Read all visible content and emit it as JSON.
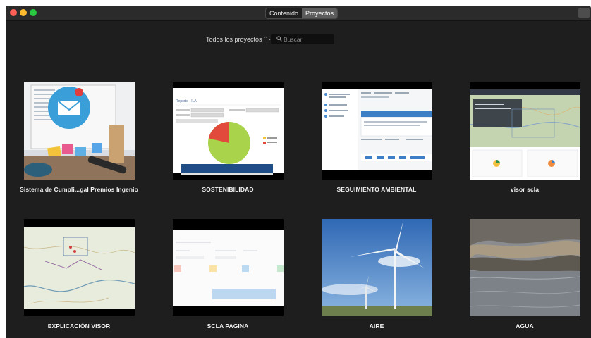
{
  "window": {
    "tabs": [
      {
        "label": "Contenido",
        "active": false
      },
      {
        "label": "Proyectos",
        "active": true
      }
    ]
  },
  "toolbar": {
    "filter_label": "Todos los proyectos",
    "filter_arrows": "⌃⌄",
    "search_placeholder": "Buscar"
  },
  "projects": [
    {
      "label": "Sistema de Cumpli...gal Premios Ingenio",
      "thumb": "mail-desk-photo"
    },
    {
      "label": "SOSTENIBILIDAD",
      "thumb": "report-pie-chart",
      "report_title": "Reporte - ILA"
    },
    {
      "label": "SEGUIMIENTO AMBIENTAL",
      "thumb": "form-screen"
    },
    {
      "label": "visor scla",
      "thumb": "map-viewer"
    },
    {
      "label": "EXPLICACIÓN VISOR",
      "thumb": "topo-map"
    },
    {
      "label": "SCLA PAGINA",
      "thumb": "faded-web-page"
    },
    {
      "label": "AIRE",
      "thumb": "wind-turbines-photo"
    },
    {
      "label": "AGUA",
      "thumb": "water-shore-photo"
    }
  ],
  "colors": {
    "window_bg": "#1e1e1e",
    "titlebar_bg": "#2b2b2b",
    "pie_green": "#a8d34a",
    "pie_red": "#e24a3b",
    "sky_blue": "#3f7bc4"
  }
}
